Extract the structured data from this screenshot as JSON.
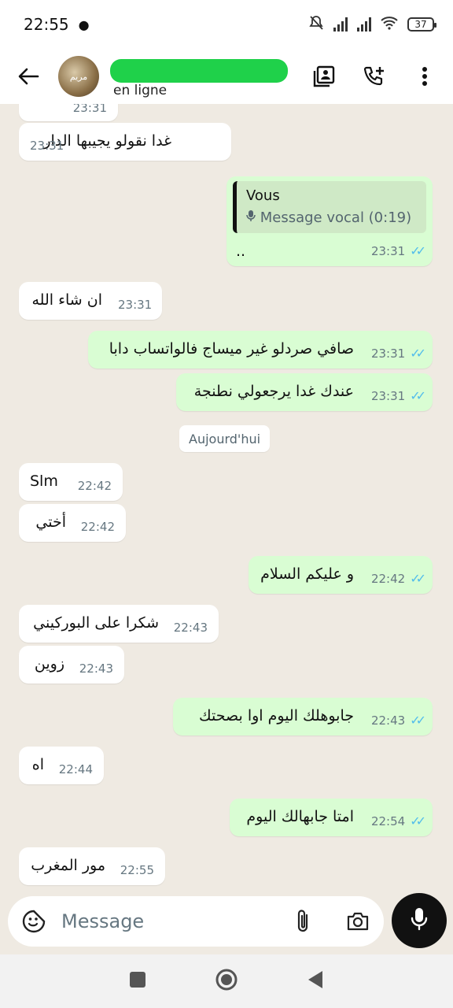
{
  "status_bar": {
    "time": "22:55",
    "battery": "37"
  },
  "header": {
    "presence": "en ligne",
    "avatar_text": "مريم"
  },
  "chat": {
    "date_divider": "Aujourd'hui",
    "messages": [
      {
        "dir": "in",
        "text": "غدا نقولو يجيبها الدار",
        "time": "23:31"
      },
      {
        "dir": "out",
        "quote_author": "Vous",
        "quote_body": "Message vocal (0:19)",
        "text": "..",
        "time": "23:31"
      },
      {
        "dir": "in",
        "text": "ان شاء الله",
        "time": "23:31"
      },
      {
        "dir": "out",
        "text": "صافي صردلو غير ميساج فالواتساب دابا",
        "time": "23:31"
      },
      {
        "dir": "out",
        "text": "عندك غدا يرجعولي نطنجة",
        "time": "23:31"
      },
      {
        "dir": "in",
        "text": "Slm",
        "time": "22:42"
      },
      {
        "dir": "in",
        "text": "أختي",
        "time": "22:42"
      },
      {
        "dir": "out",
        "text": "و عليكم السلام",
        "time": "22:42"
      },
      {
        "dir": "in",
        "text": "شكرا على البوركيني",
        "time": "22:43"
      },
      {
        "dir": "in",
        "text": "زوين",
        "time": "22:43"
      },
      {
        "dir": "out",
        "text": "جابوهلك اليوم اوا بصحتك",
        "time": "22:43"
      },
      {
        "dir": "in",
        "text": "اه",
        "time": "22:44"
      },
      {
        "dir": "out",
        "text": "امتا جابهالك اليوم",
        "time": "22:54"
      },
      {
        "dir": "in",
        "text": "مور المغرب",
        "time": "22:55"
      }
    ],
    "partial_top_time": "23:31"
  },
  "composer": {
    "placeholder": "Message"
  },
  "colors": {
    "incoming": "#ffffff",
    "outgoing": "#d9fdd3",
    "ticks": "#53bdeb",
    "chat_bg": "#efeae2"
  }
}
